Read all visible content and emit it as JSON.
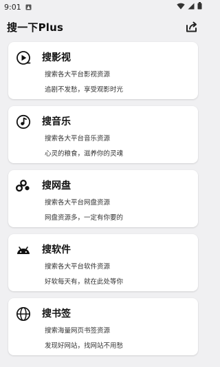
{
  "status_bar": {
    "time": "9:01"
  },
  "app_bar": {
    "title": "搜一下Plus"
  },
  "cards": [
    {
      "title": "搜影视",
      "desc": "搜索各大平台影视资源",
      "sub": "追剧不发愁，享受观影时光",
      "icon": "play-icon"
    },
    {
      "title": "搜音乐",
      "desc": "搜索各大平台音乐资源",
      "sub": "心灵的粮食，滋养你的灵魂",
      "icon": "music-note-icon"
    },
    {
      "title": "搜网盘",
      "desc": "搜索各大平台网盘资源",
      "sub": "网盘资源多，一定有你要的",
      "icon": "cloud-drive-icon"
    },
    {
      "title": "搜软件",
      "desc": "搜索各大平台软件资源",
      "sub": "好软每天有，就在此处等你",
      "icon": "android-icon"
    },
    {
      "title": "搜书签",
      "desc": "搜索海量网页书签资源",
      "sub": "发现好网站，找网站不用愁",
      "icon": "globe-icon"
    }
  ]
}
